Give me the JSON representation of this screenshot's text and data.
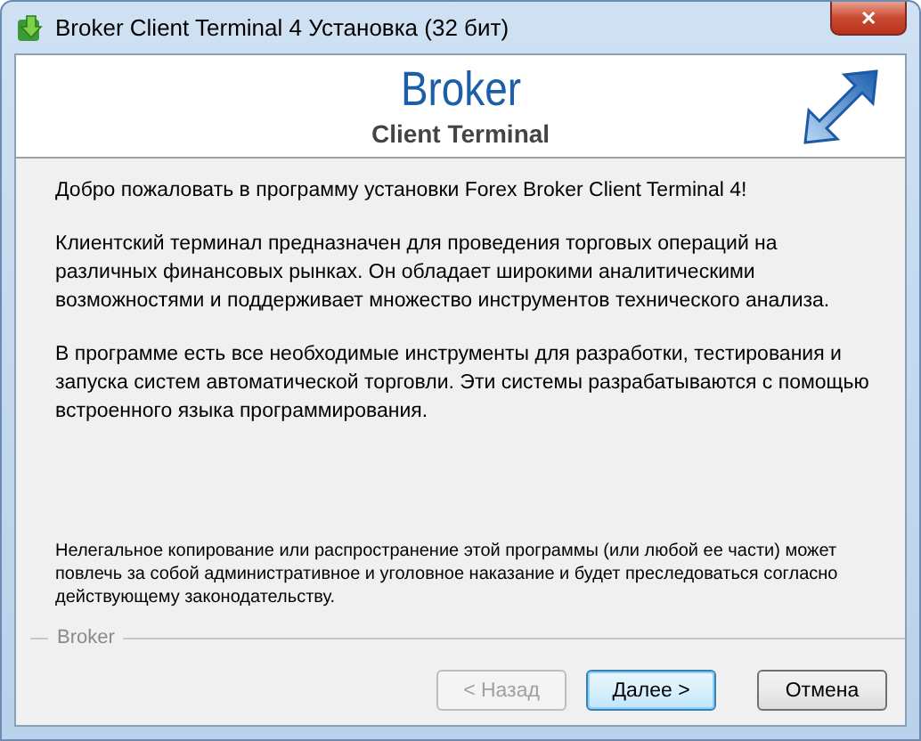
{
  "window": {
    "title": "Broker Client Terminal 4 Установка (32 бит)",
    "close": "✕"
  },
  "header": {
    "brand": "Broker",
    "subtitle": "Client Terminal"
  },
  "paragraphs": [
    "Добро пожаловать в программу установки Forex Broker Client Terminal 4!",
    "Клиентский терминал предназначен для проведения торговых операций на различных финансовых рынках. Он обладает широкими аналитическими возможностями и поддерживает множество инструментов технического анализа.",
    "В программе есть все необходимые инструменты для разработки, тестирования и запуска систем автоматической торговли. Эти системы разрабатываются с помощью встроенного языка программирования."
  ],
  "legal": "Нелегальное копирование или распространение этой программы (или любой ее части) может повлечь за собой административное и уголовное наказание и будет преследоваться согласно действующему законодательству.",
  "group_label": "Broker",
  "buttons": [
    {
      "label": "< Назад",
      "disabled": true,
      "default": false
    },
    {
      "label": "Далее >",
      "disabled": false,
      "default": true
    },
    {
      "label": "Отмена",
      "disabled": false,
      "default": false
    }
  ]
}
